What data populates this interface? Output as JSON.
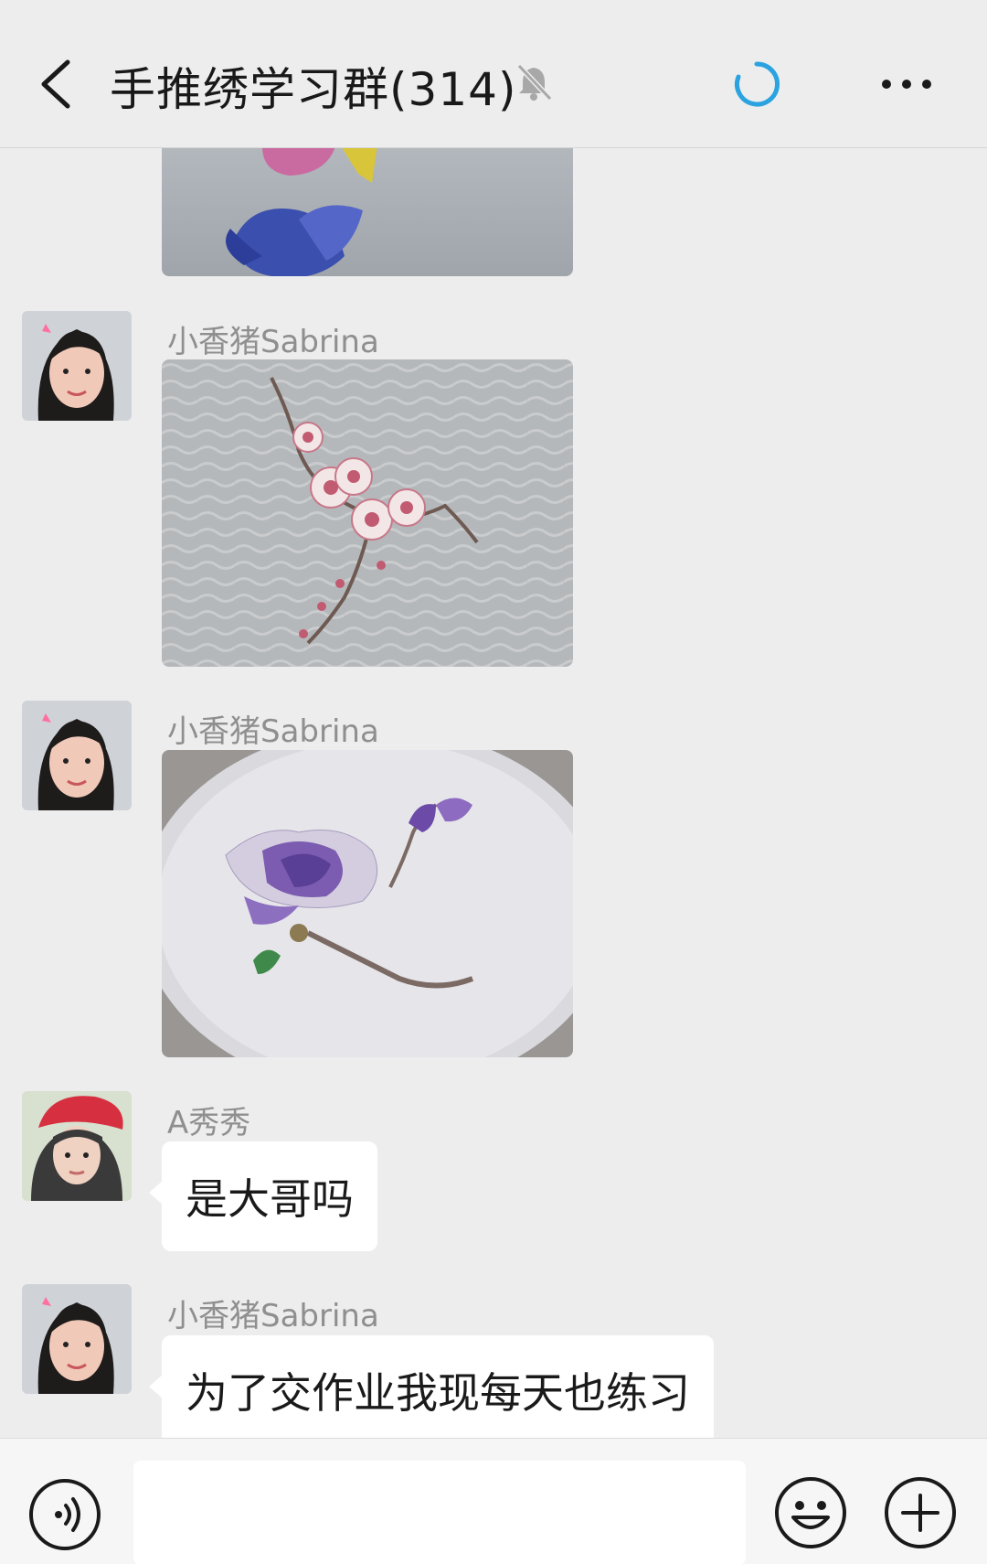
{
  "header": {
    "back_icon": "chevron-left-icon",
    "title": "手推绣学习群(314)",
    "mute_icon": "bell-off-icon",
    "loading_icon": "spinner-icon",
    "more_icon": "more-dots-icon"
  },
  "messages": [
    {
      "type": "image",
      "sender": "",
      "image": "embroidery-flower-partial"
    },
    {
      "type": "image",
      "sender": "小香猪Sabrina",
      "image": "embroidery-plum-blossom"
    },
    {
      "type": "image",
      "sender": "小香猪Sabrina",
      "image": "embroidery-magnolia-hoop"
    },
    {
      "type": "text",
      "sender": "A秀秀",
      "text": "是大哥吗"
    },
    {
      "type": "text",
      "sender": "小香猪Sabrina",
      "text": "为了交作业我现每天也练习"
    }
  ],
  "input_bar": {
    "voice_icon": "voice-icon",
    "input_value": "",
    "emoji_icon": "emoji-icon",
    "plus_icon": "plus-icon"
  },
  "colors": {
    "background": "#ededed",
    "bubble": "#ffffff",
    "spinner": "#2aa3e0",
    "sender_name": "#8f8f8f"
  }
}
